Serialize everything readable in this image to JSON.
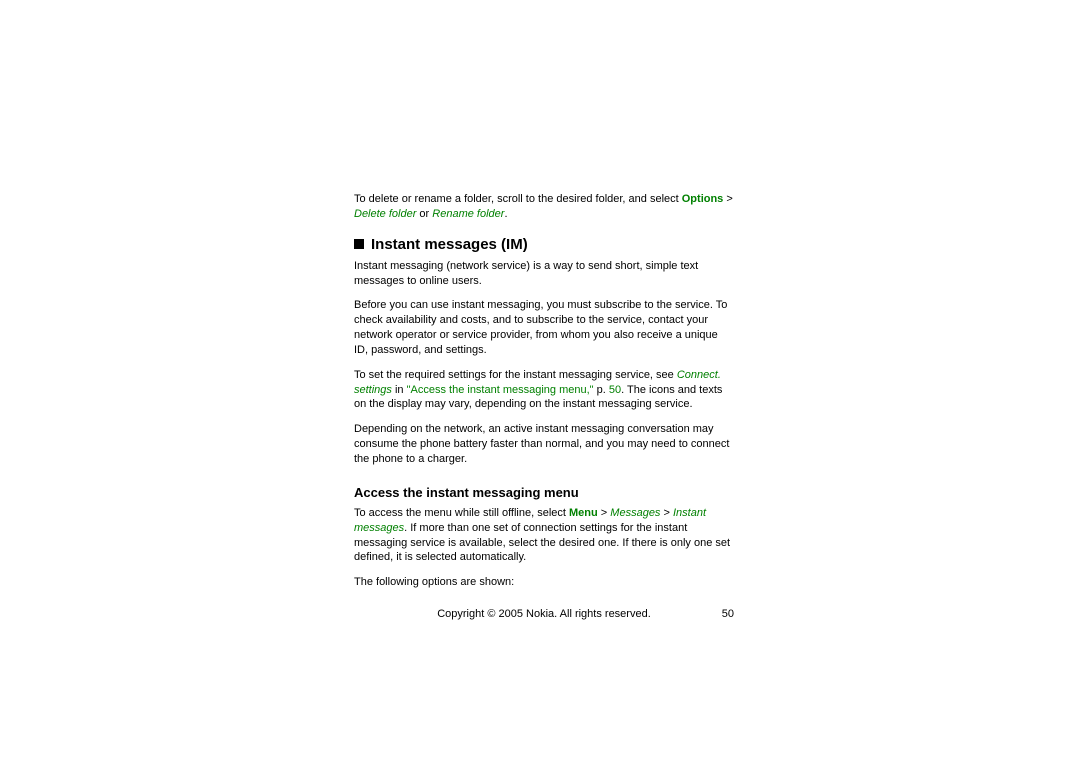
{
  "para1": {
    "t1": "To delete or rename a folder, scroll to the desired folder, and select ",
    "options": "Options",
    "gt": " > ",
    "delete": "Delete folder",
    "or": " or ",
    "rename": "Rename folder",
    "period": "."
  },
  "heading1": "Instant messages (IM)",
  "para2": "Instant messaging (network service) is a way to send short, simple text messages to online users.",
  "para3": "Before you can use instant messaging, you must subscribe to the service. To check availability and costs, and to subscribe to the service, contact your network operator or service provider, from whom you also receive a unique ID, password, and settings.",
  "para4": {
    "t1": "To set the required settings for the instant messaging service, see ",
    "connect": "Connect. settings",
    "t2": " in ",
    "link": "\"Access the instant messaging menu,\" ",
    "p": "p. ",
    "pagenum": "50",
    "t3": ". The icons and texts on the display may vary, depending on the instant messaging service."
  },
  "para5": "Depending on the network, an active instant messaging conversation may consume the phone battery faster than normal, and you may need to connect the phone to a charger.",
  "subheading1": "Access the instant messaging menu",
  "para6": {
    "t1": "To access the menu while still offline, select ",
    "menu": "Menu",
    "gt1": " > ",
    "messages": "Messages",
    "gt2": " > ",
    "instant": "Instant messages",
    "t2": ". If more than one set of connection settings for the instant messaging service is available, select the desired one. If there is only one set defined, it is selected automatically."
  },
  "para7": "The following options are shown:",
  "footer": {
    "copyright": "Copyright © 2005 Nokia. All rights reserved.",
    "page": "50"
  }
}
